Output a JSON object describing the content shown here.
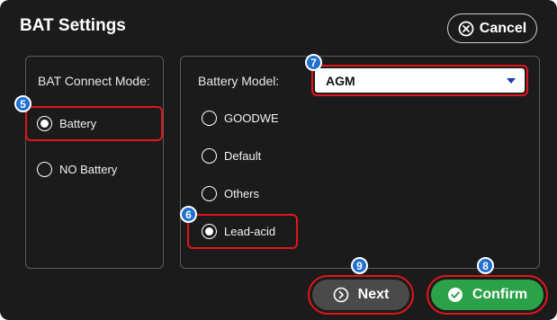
{
  "header": {
    "title": "BAT Settings",
    "cancel_label": "Cancel",
    "cancel_icon": "circle-x-icon"
  },
  "left_panel": {
    "label": "BAT Connect Mode:",
    "options": [
      {
        "label": "Battery",
        "selected": true
      },
      {
        "label": "NO Battery",
        "selected": false
      }
    ]
  },
  "right_panel": {
    "label": "Battery Model:",
    "select_value": "AGM",
    "options": [
      {
        "label": "GOODWE",
        "selected": false
      },
      {
        "label": "Default",
        "selected": false
      },
      {
        "label": "Others",
        "selected": false
      },
      {
        "label": "Lead-acid",
        "selected": true
      }
    ]
  },
  "footer": {
    "next_label": "Next",
    "confirm_label": "Confirm"
  },
  "badges": [
    "5",
    "6",
    "7",
    "8",
    "9"
  ],
  "colors": {
    "highlight": "#e3151a",
    "badge": "#1f6fd1",
    "confirm": "#2ba248",
    "next": "#4a4a4a",
    "background": "#1b1b1b"
  }
}
